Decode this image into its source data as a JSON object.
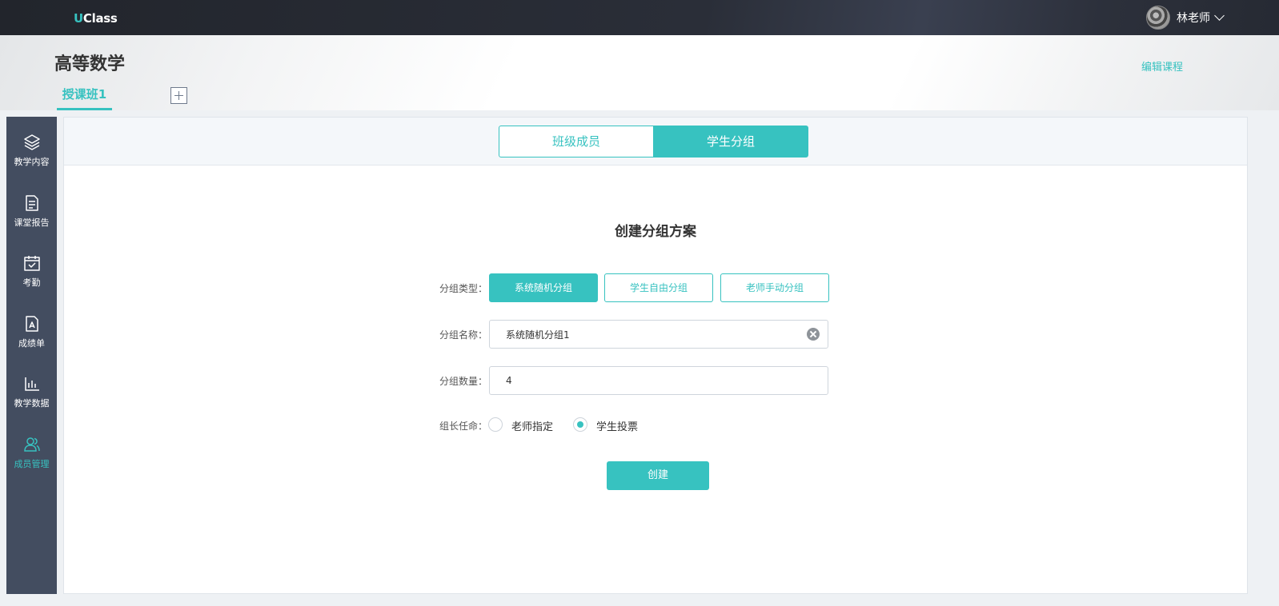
{
  "app": {
    "logo_u": "U",
    "logo_rest": "Class"
  },
  "user": {
    "name": "林老师"
  },
  "course": {
    "title": "高等数学",
    "edit_label": "编辑课程"
  },
  "class_tabs": [
    {
      "label": "授课班1"
    }
  ],
  "sidebar": {
    "items": [
      {
        "label": "教学内容",
        "icon": "layers-icon"
      },
      {
        "label": "课堂报告",
        "icon": "document-icon"
      },
      {
        "label": "考勤",
        "icon": "calendar-check-icon"
      },
      {
        "label": "成绩单",
        "icon": "grade-sheet-icon"
      },
      {
        "label": "教学数据",
        "icon": "bar-chart-icon"
      },
      {
        "label": "成员管理",
        "icon": "members-icon"
      }
    ],
    "active_index": 5
  },
  "segments": [
    {
      "label": "班级成员"
    },
    {
      "label": "学生分组"
    }
  ],
  "form": {
    "title": "创建分组方案",
    "type_label": "分组类型：",
    "type_options": [
      "系统随机分组",
      "学生自由分组",
      "老师手动分组"
    ],
    "name_label": "分组名称：",
    "name_value": "系统随机分组1",
    "count_label": "分组数量：",
    "count_value": "4",
    "leader_label": "组长任命：",
    "leader_options": [
      "老师指定",
      "学生投票"
    ],
    "leader_selected": "学生投票",
    "submit_label": "创建"
  },
  "colors": {
    "accent": "#37c2c0",
    "sidebar": "#434d60",
    "topbar": "#262a33"
  }
}
